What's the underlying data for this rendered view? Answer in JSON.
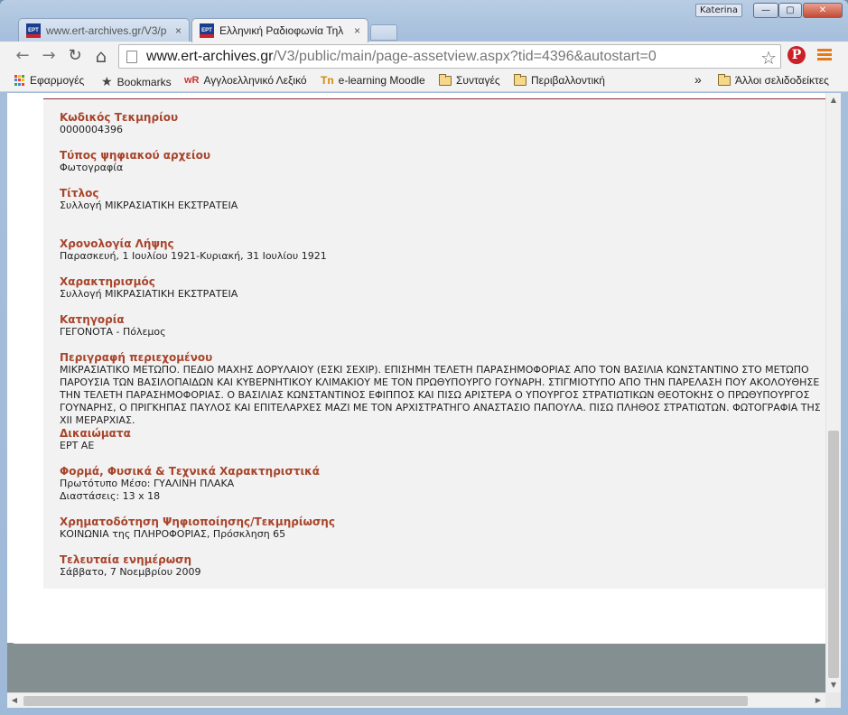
{
  "window": {
    "user_badge": "Katerina",
    "min_glyph": "—",
    "max_glyph": "▢",
    "close_glyph": "✕"
  },
  "tabs": [
    {
      "favicon_text": "ΕΡΤ",
      "title": "www.ert-archives.gr/V3/p",
      "close": "×"
    },
    {
      "favicon_text": "ΕΡΤ",
      "title": "Ελληνική Ραδιοφωνία Τηλ",
      "close": "×"
    }
  ],
  "toolbar": {
    "back": "←",
    "forward": "→",
    "reload": "↻",
    "home": "⌂",
    "url_host": "www.ert-archives.gr",
    "url_path": "/V3/public/main/page-assetview.aspx?tid=4396&autostart=0",
    "star": "☆",
    "pinterest": "P"
  },
  "bookmarks": {
    "apps": "Εφαρμογές",
    "bookmarks": "Bookmarks",
    "dictionary_prefix": "wR",
    "dictionary": "Αγγλοελληνικό Λεξικό",
    "moodle_prefix": "Tn",
    "moodle": "e-learning Moodle",
    "recipes": "Συνταγές",
    "environmental": "Περιβαλλοντική",
    "overflow": "»",
    "other": "Άλλοι σελιδοδείκτες"
  },
  "record": {
    "code_label": "Κωδικός Τεκμηρίου",
    "code_value": "0000004396",
    "filetype_label": "Τύπος ψηφιακού αρχείου",
    "filetype_value": "Φωτογραφία",
    "title_label": "Τίτλος",
    "title_value": "Συλλογή ΜΙΚΡΑΣΙΑΤΙΚΗ ΕΚΣΤΡΑΤΕΙΑ",
    "date_label": "Χρονολογία Λήψης",
    "date_value": "Παρασκευή, 1 Ιουλίου 1921-Κυριακή, 31 Ιουλίου 1921",
    "characterization_label": "Χαρακτηρισμός",
    "characterization_value": "Συλλογή ΜΙΚΡΑΣΙΑΤΙΚΗ ΕΚΣΤΡΑΤΕΙΑ",
    "category_label": "Κατηγορία",
    "category_value": "ΓΕΓΟΝΟΤΑ - Πόλεμος",
    "description_label": "Περιγραφή περιεχομένου",
    "description_value": "ΜΙΚΡΑΣΙΑΤΙΚΟ ΜΕΤΩΠΟ. ΠΕΔΙΟ ΜΑΧΗΣ ΔΟΡΥΛΑΙΟΥ (ΕΣΚΙ ΣΕΧΙΡ). ΕΠΙΣΗΜΗ ΤΕΛΕΤΗ ΠΑΡΑΣΗΜΟΦΟΡΙΑΣ ΑΠΟ ΤΟΝ ΒΑΣΙΛΙΑ ΚΩΝΣΤΑΝΤΙΝΟ ΣΤΟ ΜΕΤΩΠΟ ΠΑΡΟΥΣΙΑ ΤΩΝ ΒΑΣΙΛΟΠΑΙΔΩΝ ΚΑΙ ΚΥΒΕΡΝΗΤΙΚΟΥ ΚΛΙΜΑΚΙΟΥ ΜΕ ΤΟΝ ΠΡΩΘΥΠΟΥΡΓΟ ΓΟΥΝΑΡΗ. ΣΤΙΓΜΙΟΤΥΠΟ ΑΠΟ ΤΗΝ ΠΑΡΕΛΑΣΗ ΠΟΥ ΑΚΟΛΟΥΘΗΣΕ ΤΗΝ ΤΕΛΕΤΗ ΠΑΡΑΣΗΜΟΦΟΡΙΑΣ. Ο ΒΑΣΙΛΙΑΣ ΚΩΝΣΤΑΝΤΙΝΟΣ ΕΦΙΠΠΟΣ ΚΑΙ ΠΙΣΩ ΑΡΙΣΤΕΡΑ Ο ΥΠΟΥΡΓΟΣ ΣΤΡΑΤΙΩΤΙΚΩΝ ΘΕΟΤΟΚΗΣ Ο ΠΡΩΘΥΠΟΥΡΓΟΣ ΓΟΥΝΑΡΗΣ, Ο ΠΡΙΓΚΗΠΑΣ ΠΑΥΛΟΣ ΚΑΙ ΕΠΙΤΕΛΑΡΧΕΣ ΜΑΖΙ ΜΕ ΤΟΝ ΑΡΧΙΣΤΡΑΤΗΓΟ ΑΝΑΣΤΑΣΙΟ ΠΑΠΟΥΛΑ. ΠΙΣΩ ΠΛΗΘΟΣ ΣΤΡΑΤΙΩΤΩΝ. ΦΩΤΟΓΡΑΦΙΑ ΤΗΣ XII ΜΕΡΑΡΧΙΑΣ.",
    "rights_label": "Δικαιώματα",
    "rights_value": "ΕΡΤ ΑΕ",
    "format_label": "Φορμά, Φυσικά & Τεχνικά Χαρακτηριστικά",
    "format_medium": "Πρωτότυπο Μέσο: ΓΥΑΛΙΝΗ ΠΛΑΚΑ",
    "format_dimensions": "Διαστάσεις: 13 x 18",
    "funding_label": "Χρηματοδότηση Ψηφιοποίησης/Τεκμηρίωσης",
    "funding_value": "ΚΟΙΝΩΝΙΑ της ΠΛΗΡΟΦΟΡΙΑΣ, Πρόσκληση 65",
    "updated_label": "Τελευταία ενημέρωση",
    "updated_value": "Σάββατο, 7 Νοεμβρίου 2009"
  },
  "scrollbars": {
    "up": "▲",
    "down": "▼",
    "left": "◀",
    "right": "▶",
    "vertical_position": 0.58,
    "horizontal_position": 0.0
  }
}
